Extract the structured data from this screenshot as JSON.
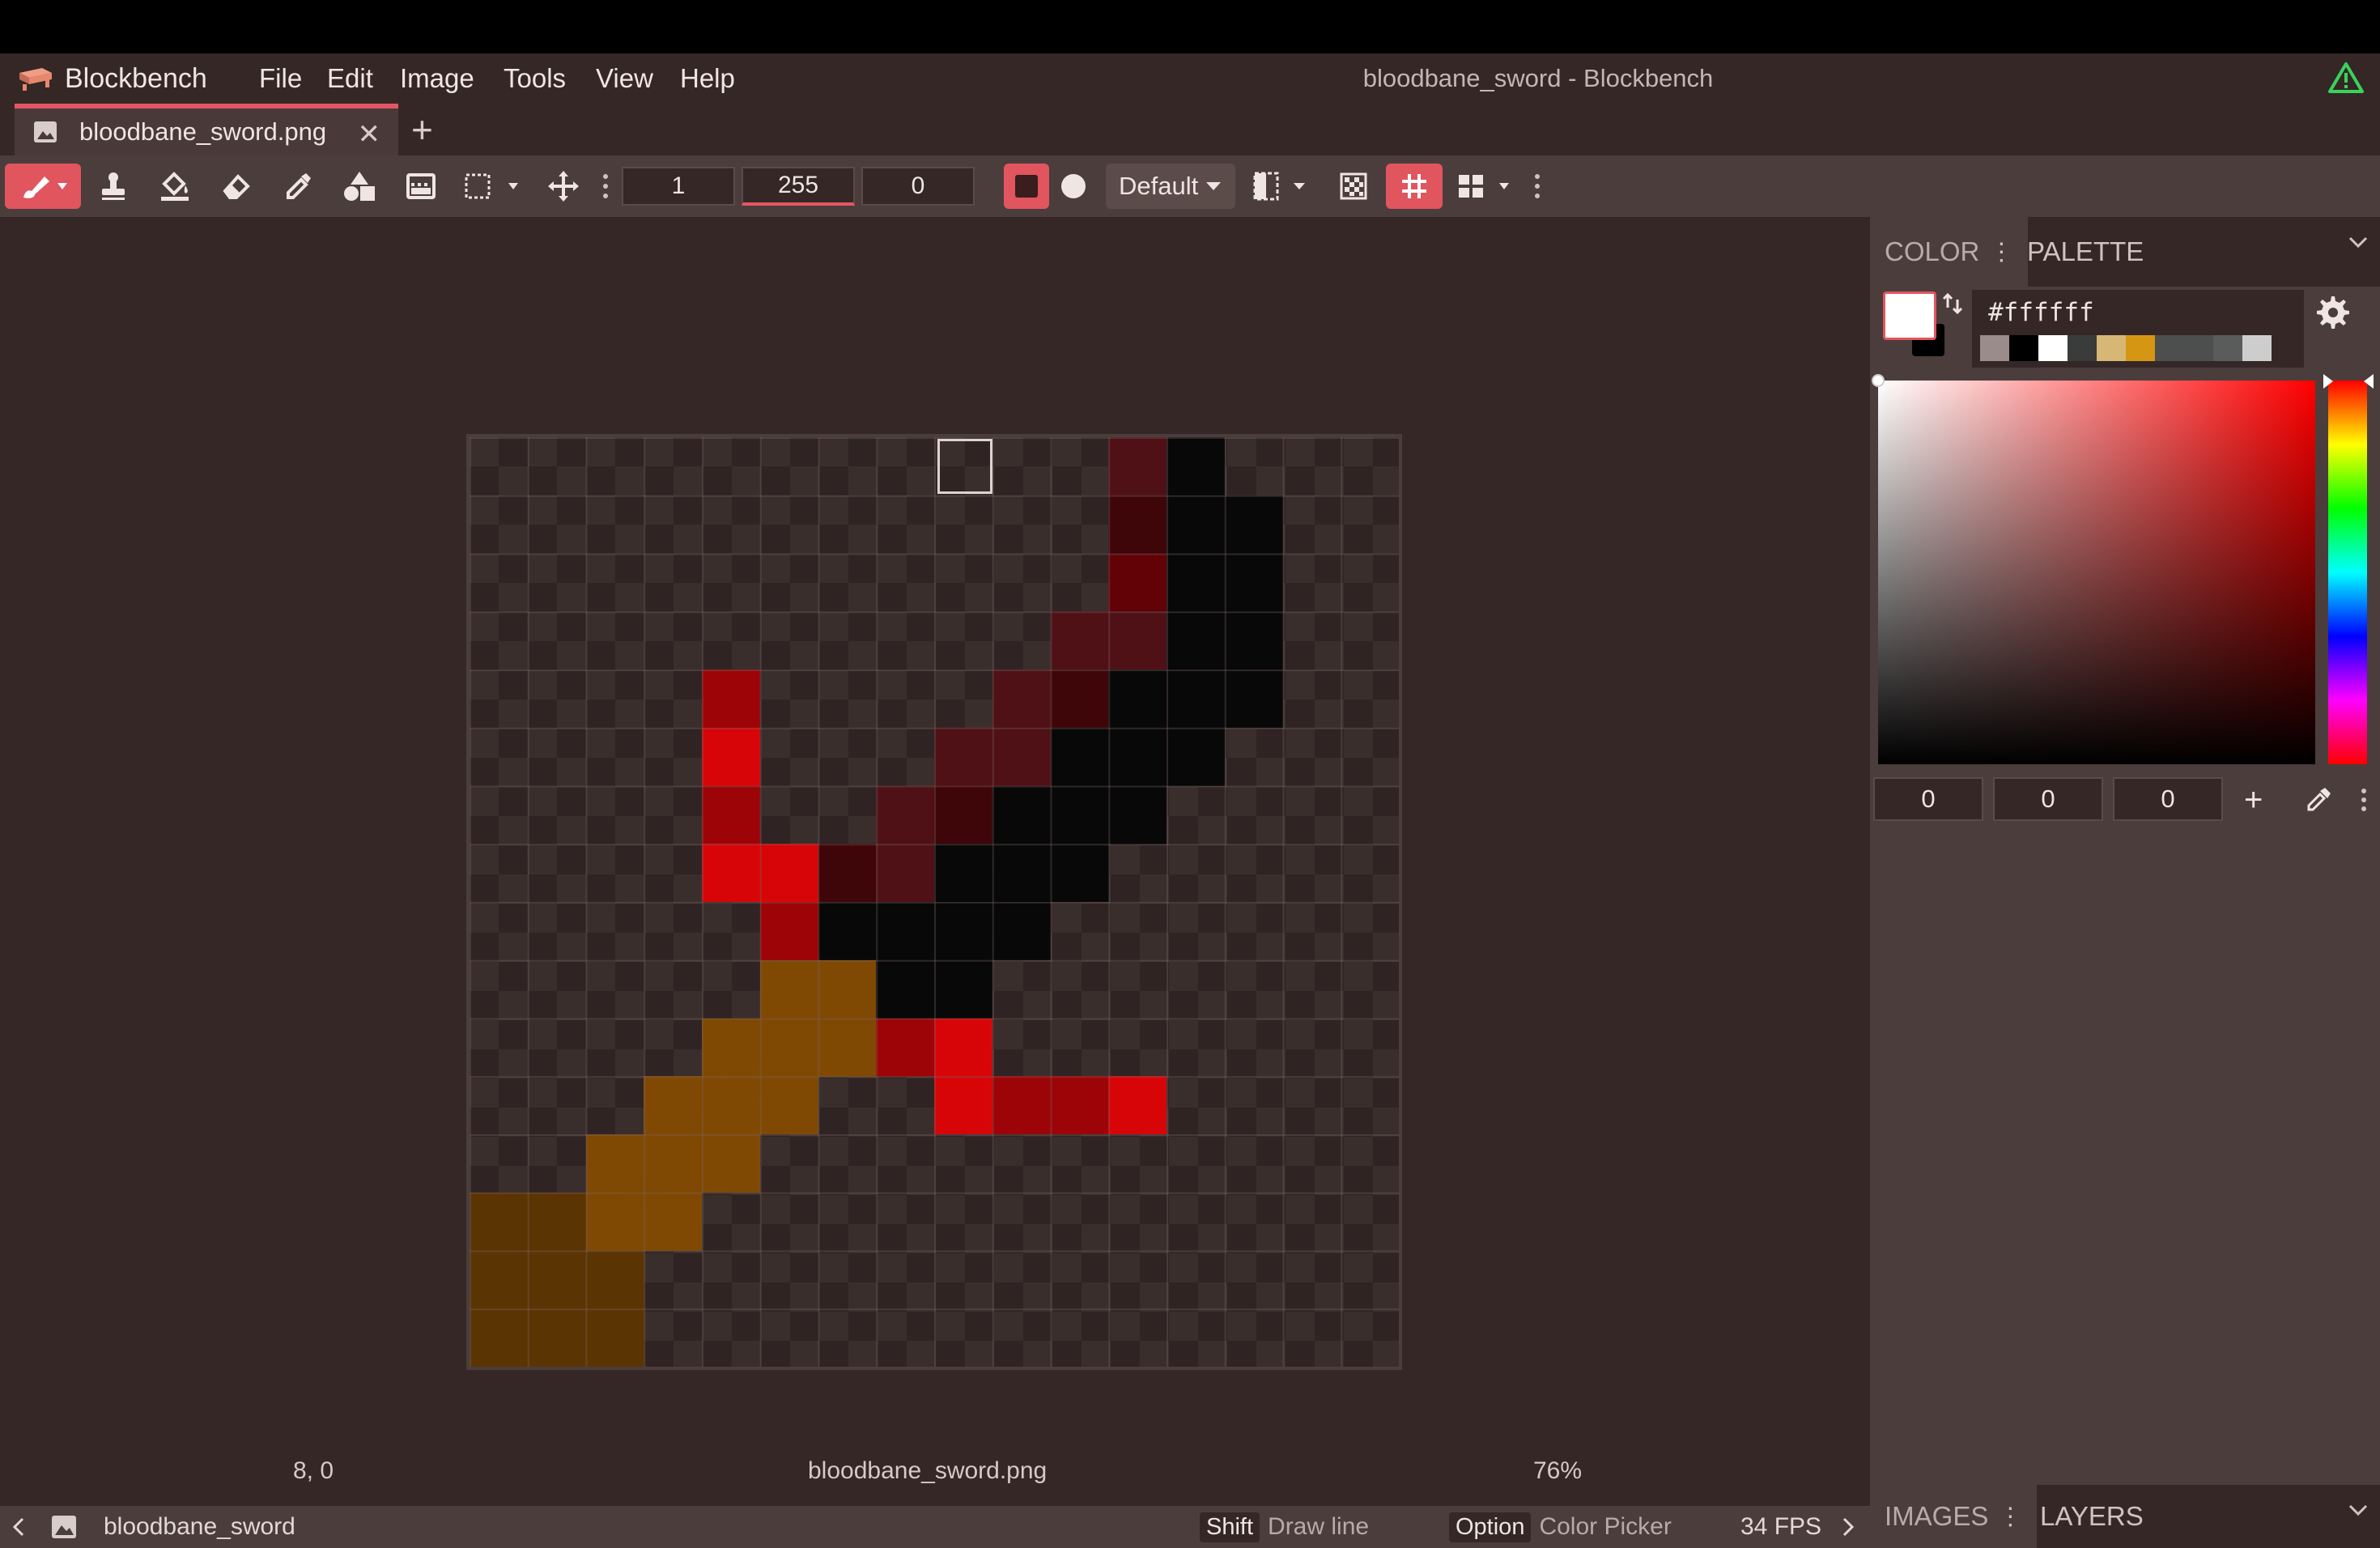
{
  "app": {
    "name": "Blockbench",
    "window_title": "bloodbane_sword - Blockbench",
    "menu": [
      "File",
      "Edit",
      "Image",
      "Tools",
      "View",
      "Help"
    ]
  },
  "tabs": [
    {
      "label": "bloodbane_sword.png"
    }
  ],
  "toolbar": {
    "tools": [
      "brush-icon",
      "stamp-icon",
      "fill-icon",
      "eraser-icon",
      "color-picker-icon",
      "shapes-icon",
      "gradient-icon",
      "selection-icon",
      "move-icon"
    ],
    "brush_size": "1",
    "opacity": "255",
    "softness": "0",
    "blend_mode": "Default"
  },
  "canvas": {
    "file": "bloodbane_sword.png",
    "resolution": 16,
    "hovered_pixel": "8, 0",
    "zoom": "76%",
    "colors": {
      "A": "#4f1116",
      "B": "#3e0608",
      "C": "#620207",
      "D": "#080808",
      "E": "#9c0407",
      "F": "#d80508",
      "G": "#7f4904",
      "H": "#5b3403"
    },
    "rows": [
      "................",
      "...........AD...",
      "...........BDD..",
      "...........CDD..",
      "..........AADD..",
      "....E....ABDDD..",
      "....F...AADDD...",
      "....E..ABDDD....",
      "....FFBADDD.....",
      ".....EDDDD......",
      ".....GGDD.......",
      "....GGGEF.......",
      "...GGG..FEEF....",
      "..GGG...........",
      "HHGG............",
      "HHH.............",
      "HHH............."
    ]
  },
  "status": {
    "coords": "8, 0",
    "filename": "bloodbane_sword.png",
    "zoom": "76%"
  },
  "bottom_bar": {
    "project": "bloodbane_sword",
    "hint1_key": "Shift",
    "hint1_text": "Draw line",
    "hint2_key": "Option",
    "hint2_text": "Color Picker",
    "fps": "34 FPS"
  },
  "color_panel": {
    "tab_color": "COLOR",
    "tab_palette": "PALETTE",
    "hex": "#ffffff",
    "history": [
      "#9a8c8a",
      "#000000",
      "#ffffff",
      "#3a3b3b",
      "#d6b775",
      "#d49613",
      "#4d4e4e",
      "#4d4e4e",
      "#5a5b5b",
      "#cdcdcd"
    ],
    "rgb": [
      "0",
      "0",
      "0"
    ]
  },
  "bottom_panel": {
    "tab_images": "IMAGES",
    "tab_layers": "LAYERS"
  }
}
